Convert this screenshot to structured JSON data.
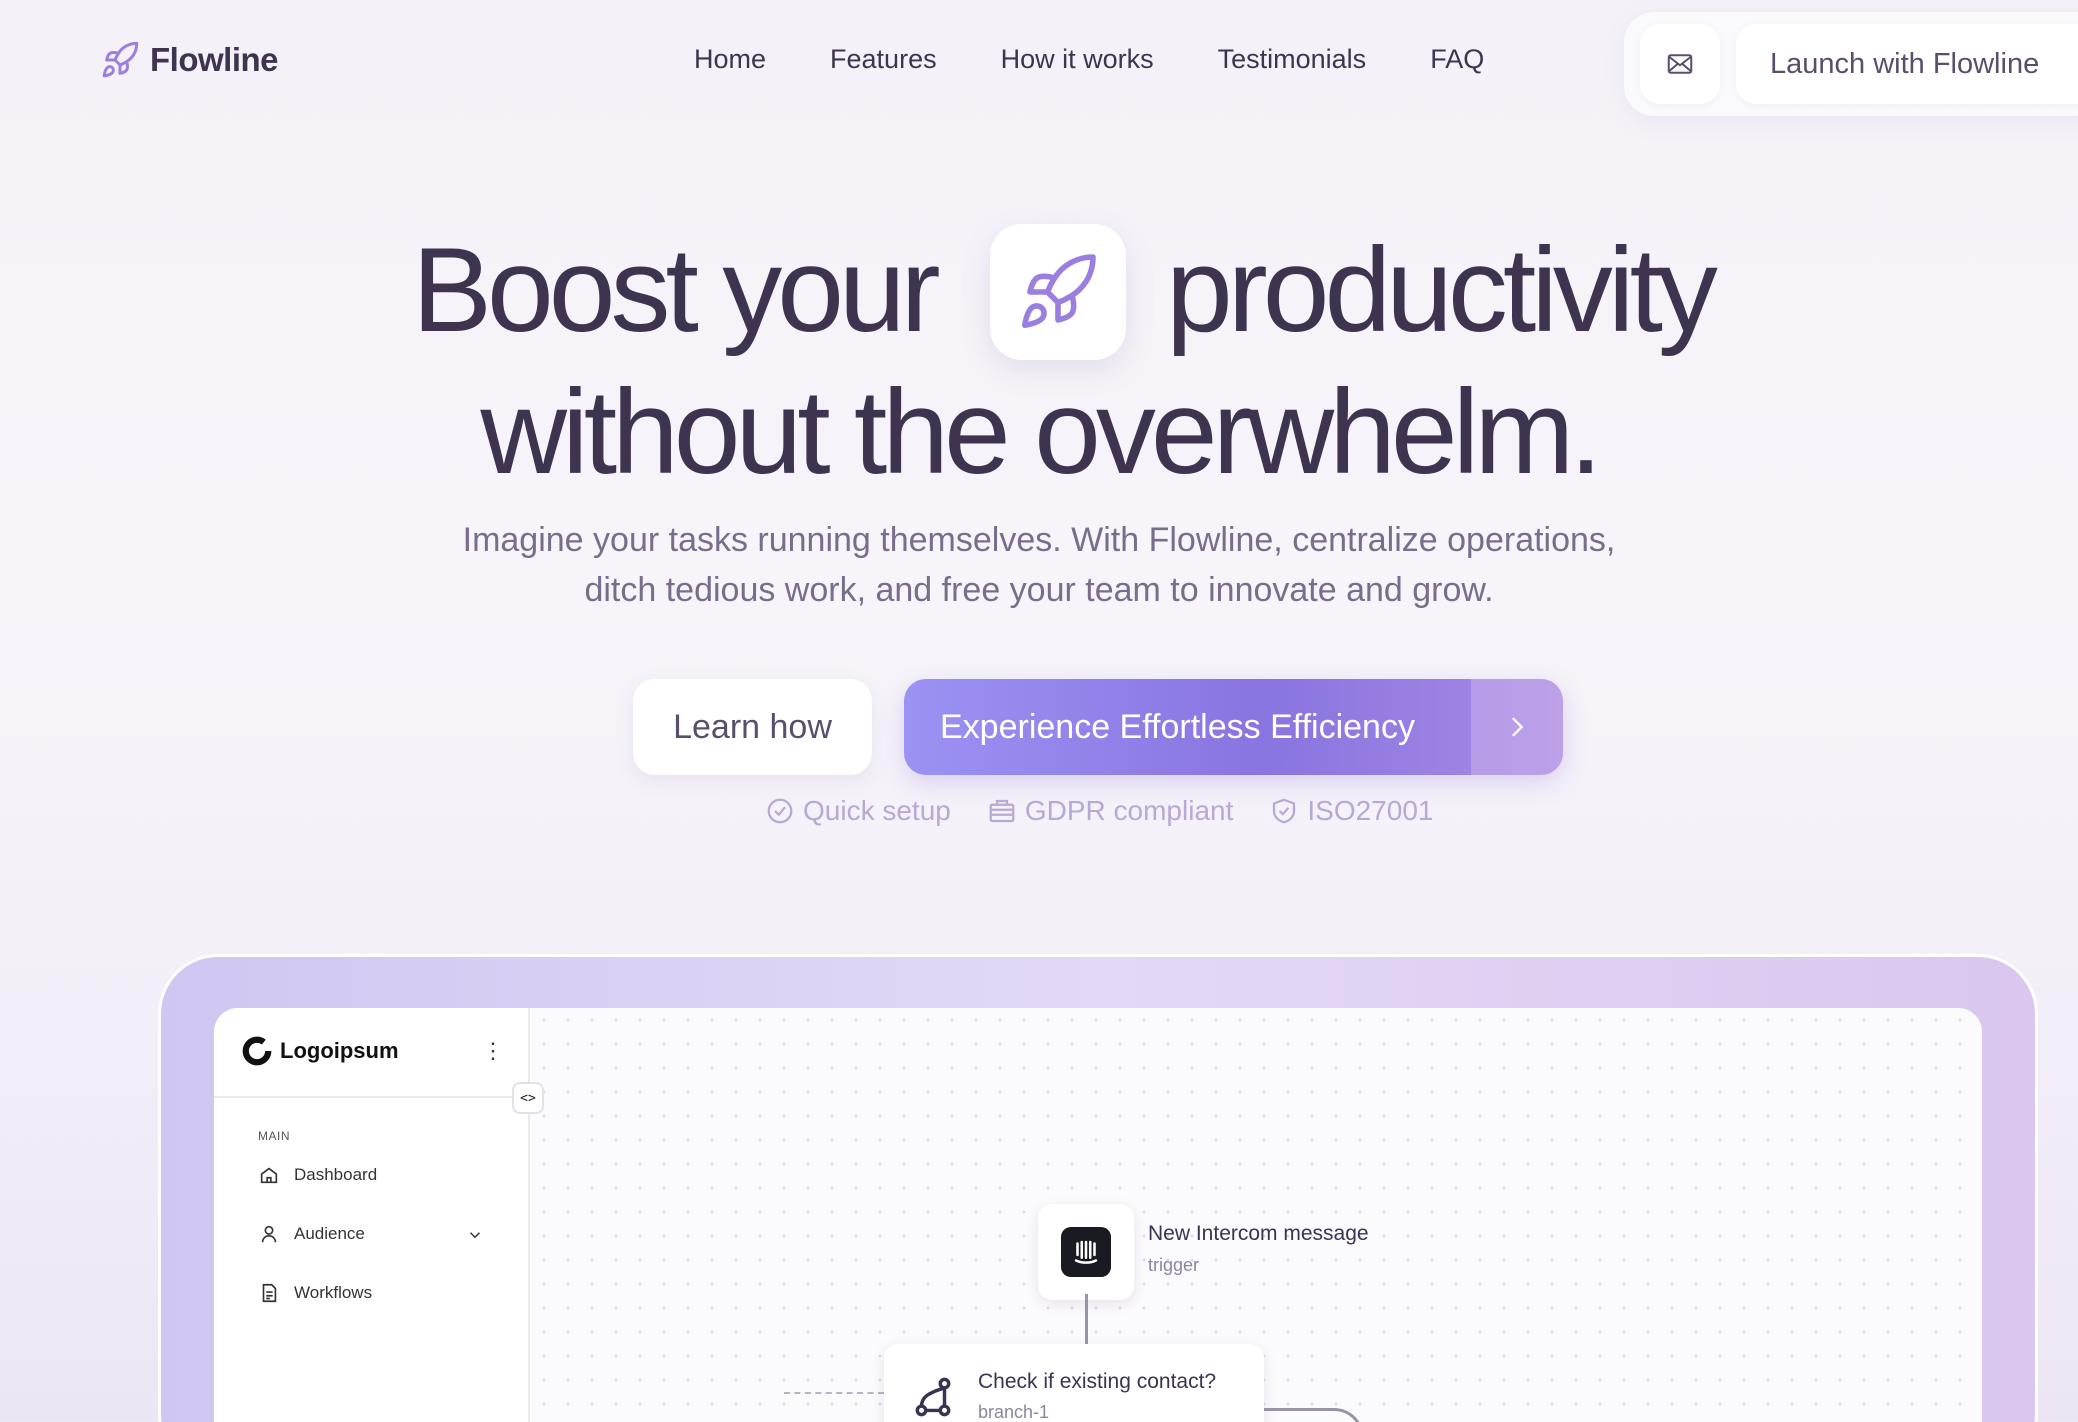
{
  "brand": {
    "name": "Flowline",
    "accent": "#9b7fe0",
    "text": "#3f3450"
  },
  "nav": {
    "links": [
      "Home",
      "Features",
      "How it works",
      "Testimonials",
      "FAQ"
    ],
    "mail_icon": "mail-icon",
    "cta": "Launch with Flowline"
  },
  "hero": {
    "line1_a": "Boost your",
    "line1_b": "productivity",
    "line2": "without the overwhelm.",
    "subtitle_1": "Imagine your tasks running themselves. With Flowline, centralize operations,",
    "subtitle_2": "ditch tedious work, and free your team to innovate and grow.",
    "secondary_cta": "Learn how",
    "primary_cta": "Experience Effortless Efficiency",
    "badges": [
      "Quick setup",
      "GDPR compliant",
      "ISO27001"
    ]
  },
  "app": {
    "logo": "Logoipsum",
    "section": "MAIN",
    "sidebar": [
      {
        "label": "Dashboard",
        "icon": "home-icon"
      },
      {
        "label": "Audience",
        "icon": "user-icon"
      },
      {
        "label": "Workflows",
        "icon": "document-icon"
      }
    ],
    "collapse": "<>",
    "nodes": [
      {
        "title": "New Intercom message",
        "sub": "trigger",
        "icon": "intercom-icon"
      },
      {
        "title": "Check if existing contact?",
        "sub": "branch-1",
        "icon": "branch-icon"
      }
    ]
  }
}
